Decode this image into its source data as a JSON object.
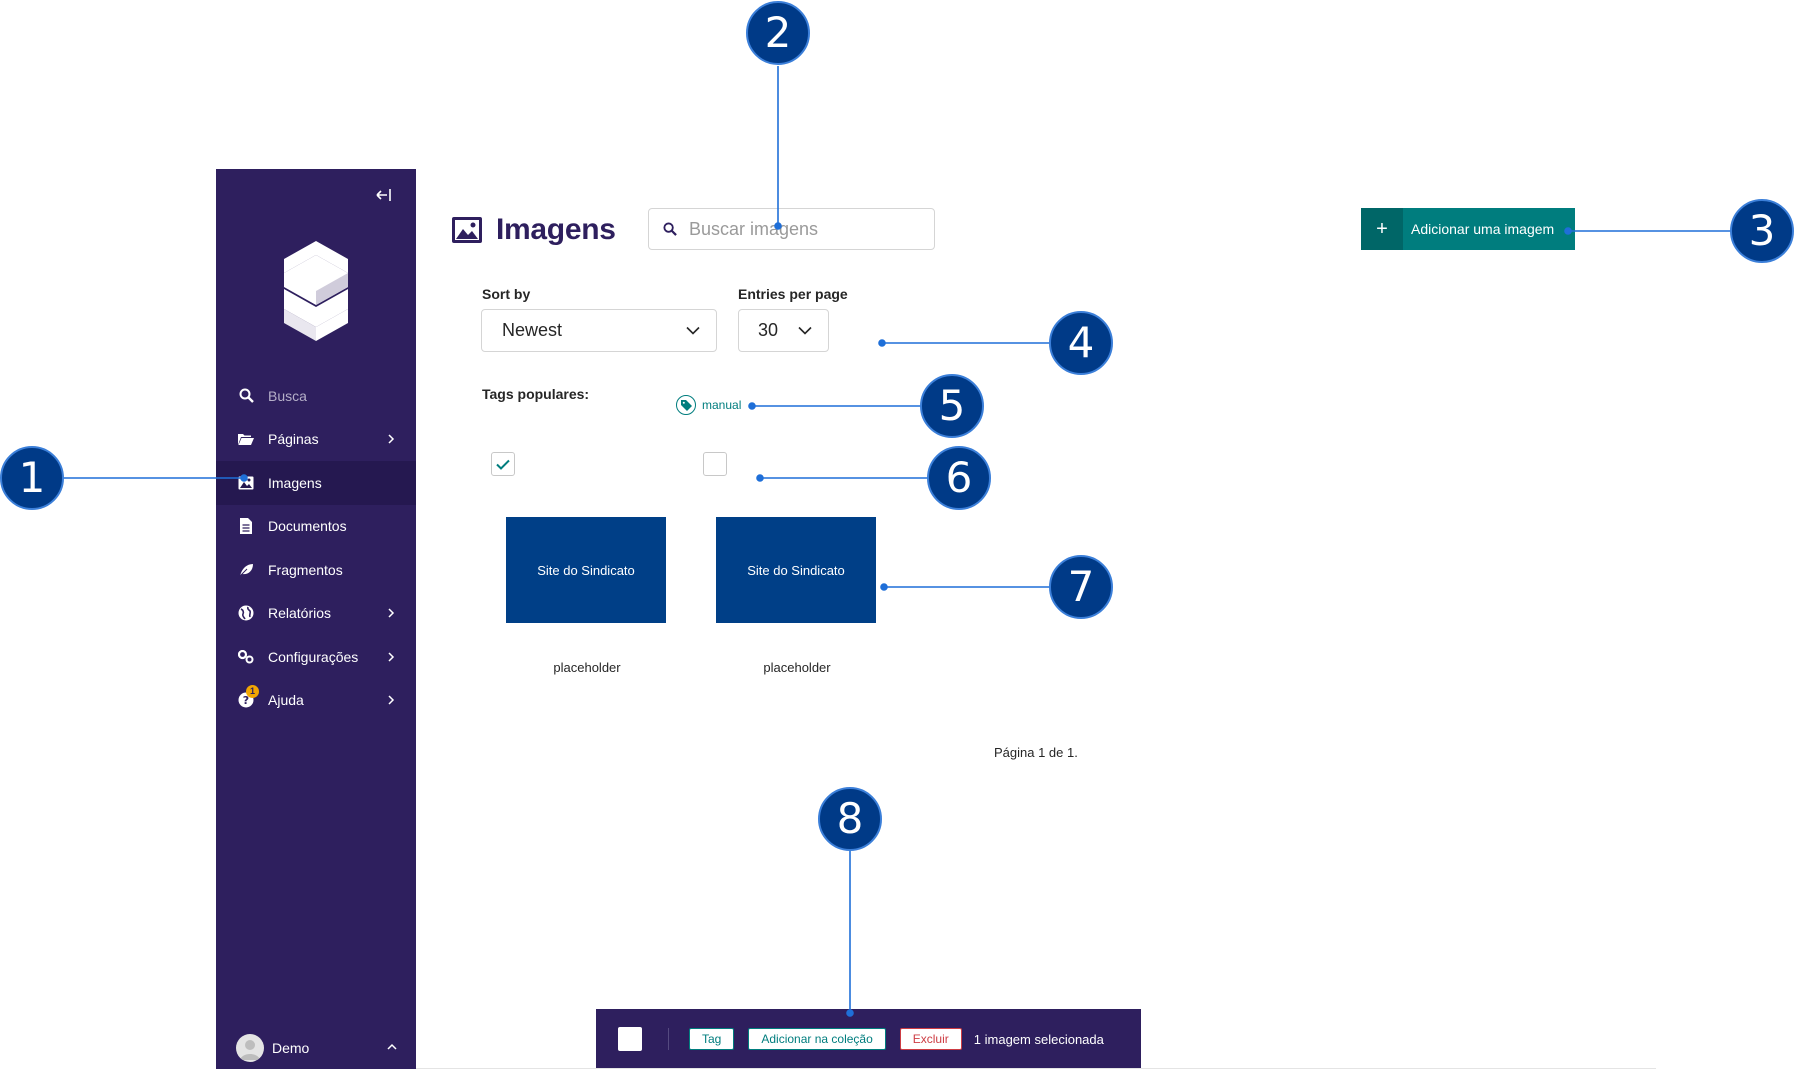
{
  "sidebar": {
    "collapse_icon": "collapse-left-icon",
    "logo": "wagtail-style-logo",
    "search_label": "Busca",
    "items": [
      {
        "label": "Páginas",
        "icon": "folder-open-icon",
        "has_submenu": true
      },
      {
        "label": "Imagens",
        "icon": "image-icon",
        "has_submenu": false,
        "active": true
      },
      {
        "label": "Documentos",
        "icon": "document-icon",
        "has_submenu": false
      },
      {
        "label": "Fragmentos",
        "icon": "leaf-icon",
        "has_submenu": false
      },
      {
        "label": "Relatórios",
        "icon": "globe-icon",
        "has_submenu": true
      },
      {
        "label": "Configurações",
        "icon": "cogs-icon",
        "has_submenu": true
      },
      {
        "label": "Ajuda",
        "icon": "help-icon",
        "has_submenu": true,
        "badge": "1"
      }
    ],
    "account": {
      "name": "Demo"
    }
  },
  "header": {
    "title": "Imagens",
    "search_placeholder": "Buscar imagens",
    "add_button": "Adicionar uma imagem"
  },
  "filters": {
    "sort_label": "Sort by",
    "sort_value": "Newest",
    "entries_label": "Entries per page",
    "entries_value": "30",
    "popular_tags_label": "Tags populares:",
    "tags": [
      "manual"
    ]
  },
  "images": [
    {
      "thumb_text": "Site do Sindicato",
      "title": "placeholder",
      "selected": true
    },
    {
      "thumb_text": "Site do Sindicato",
      "title": "placeholder",
      "selected": false
    }
  ],
  "pagination": "Página 1 de 1.",
  "bulk_actions": {
    "tag_button": "Tag",
    "collection_button": "Adicionar na coleção",
    "delete_button": "Excluir",
    "status": "1 imagem selecionada"
  },
  "callouts": [
    "1",
    "2",
    "3",
    "4",
    "5",
    "6",
    "7",
    "8"
  ],
  "colors": {
    "sidebar": "#2e1f5e",
    "primary": "#007d7e",
    "thumbnail": "#003f87",
    "callout": "#003a87",
    "callout_line": "#1f6fd8",
    "danger": "#cd3c43"
  }
}
